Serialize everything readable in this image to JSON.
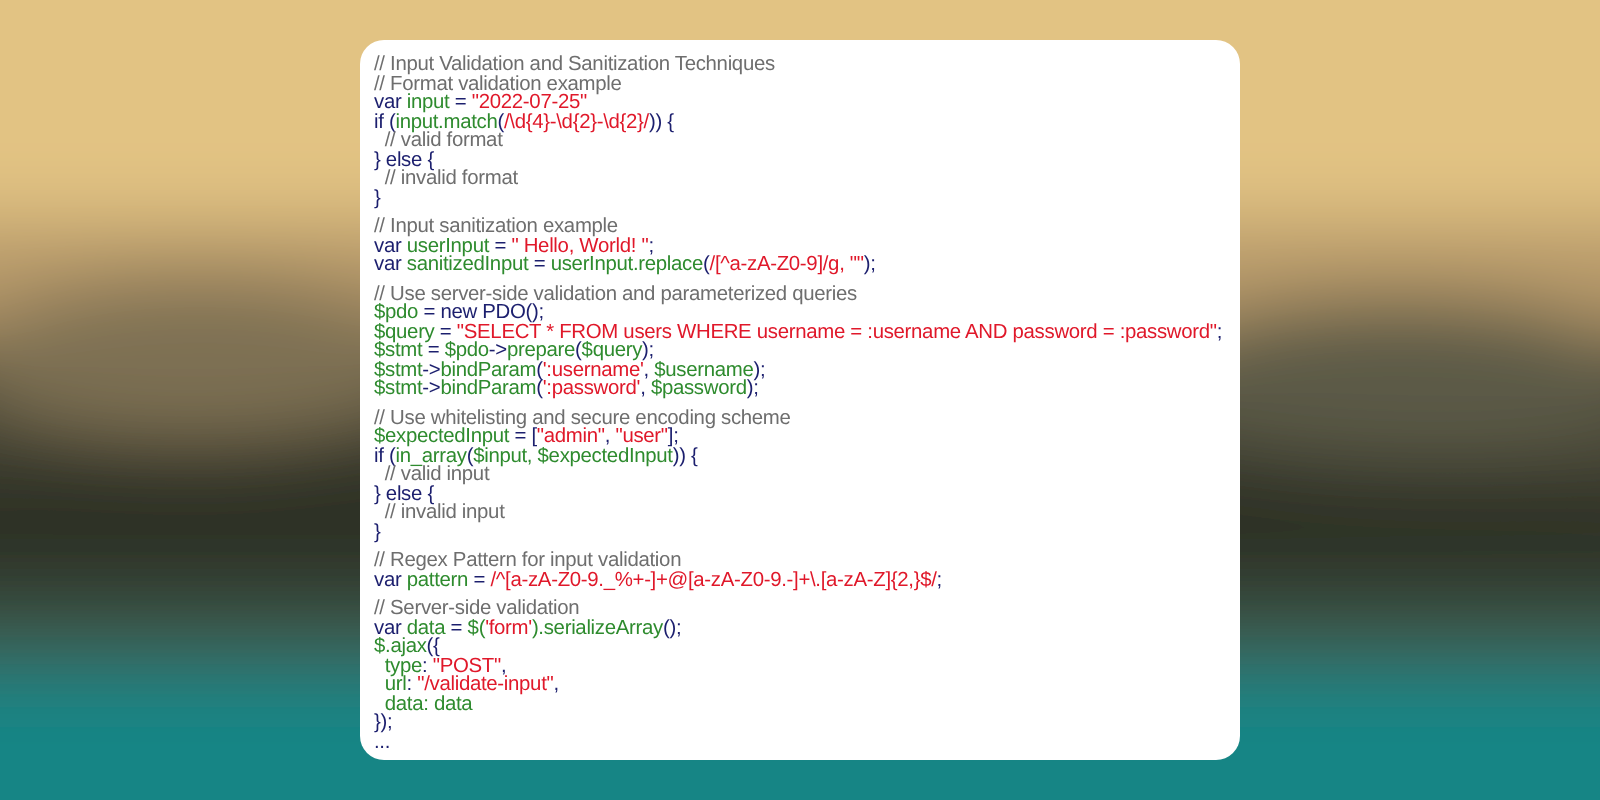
{
  "code_blocks": [
    {
      "lines": [
        [
          {
            "kind": "comment",
            "text": "// Input Validation and Sanitization Techniques"
          }
        ],
        [
          {
            "kind": "comment",
            "text": "// Format validation example"
          }
        ],
        [
          {
            "kind": "keyword",
            "text": "var "
          },
          {
            "kind": "ident",
            "text": "input"
          },
          {
            "kind": "keyword",
            "text": " = "
          },
          {
            "kind": "string",
            "text": "\"2022-07-25\""
          }
        ],
        [
          {
            "kind": "keyword",
            "text": "if ("
          },
          {
            "kind": "ident",
            "text": "input.match"
          },
          {
            "kind": "keyword",
            "text": "("
          },
          {
            "kind": "string",
            "text": "/\\d{4}-\\d{2}-\\d{2}/"
          },
          {
            "kind": "keyword",
            "text": ")) {"
          }
        ],
        [
          {
            "kind": "comment",
            "text": "  // valid format"
          }
        ],
        [
          {
            "kind": "keyword",
            "text": "} else {"
          }
        ],
        [
          {
            "kind": "comment",
            "text": "  // invalid format"
          }
        ],
        [
          {
            "kind": "keyword",
            "text": "}"
          }
        ]
      ]
    },
    {
      "lines": [
        [
          {
            "kind": "comment",
            "text": "// Input sanitization example"
          }
        ],
        [
          {
            "kind": "keyword",
            "text": "var "
          },
          {
            "kind": "ident",
            "text": "userInput"
          },
          {
            "kind": "keyword",
            "text": " = "
          },
          {
            "kind": "string",
            "text": "\" Hello, World! \""
          },
          {
            "kind": "keyword",
            "text": ";"
          }
        ],
        [
          {
            "kind": "keyword",
            "text": "var "
          },
          {
            "kind": "ident",
            "text": "sanitizedInput"
          },
          {
            "kind": "keyword",
            "text": " = "
          },
          {
            "kind": "ident",
            "text": "userInput.replace"
          },
          {
            "kind": "keyword",
            "text": "("
          },
          {
            "kind": "string",
            "text": "/[^a-zA-Z0-9]/g, \"\""
          },
          {
            "kind": "keyword",
            "text": ");"
          }
        ]
      ]
    },
    {
      "lines": [
        [
          {
            "kind": "comment",
            "text": "// Use server-side validation and parameterized queries"
          }
        ],
        [
          {
            "kind": "ident",
            "text": "$pdo"
          },
          {
            "kind": "keyword",
            "text": " = new PDO();"
          }
        ],
        [
          {
            "kind": "ident",
            "text": "$query"
          },
          {
            "kind": "keyword",
            "text": " = "
          },
          {
            "kind": "string",
            "text": "\"SELECT * FROM users WHERE username = :username AND password = :password\""
          },
          {
            "kind": "keyword",
            "text": ";"
          }
        ],
        [
          {
            "kind": "ident",
            "text": "$stmt"
          },
          {
            "kind": "keyword",
            "text": " = "
          },
          {
            "kind": "ident",
            "text": "$pdo"
          },
          {
            "kind": "keyword",
            "text": "->"
          },
          {
            "kind": "ident",
            "text": "prepare"
          },
          {
            "kind": "keyword",
            "text": "("
          },
          {
            "kind": "ident",
            "text": "$query"
          },
          {
            "kind": "keyword",
            "text": ");"
          }
        ],
        [
          {
            "kind": "ident",
            "text": "$stmt"
          },
          {
            "kind": "keyword",
            "text": "->"
          },
          {
            "kind": "ident",
            "text": "bindParam"
          },
          {
            "kind": "keyword",
            "text": "("
          },
          {
            "kind": "string",
            "text": "':username'"
          },
          {
            "kind": "keyword",
            "text": ", "
          },
          {
            "kind": "ident",
            "text": "$username"
          },
          {
            "kind": "keyword",
            "text": ");"
          }
        ],
        [
          {
            "kind": "ident",
            "text": "$stmt"
          },
          {
            "kind": "keyword",
            "text": "->"
          },
          {
            "kind": "ident",
            "text": "bindParam"
          },
          {
            "kind": "keyword",
            "text": "("
          },
          {
            "kind": "string",
            "text": "':password'"
          },
          {
            "kind": "keyword",
            "text": ", "
          },
          {
            "kind": "ident",
            "text": "$password"
          },
          {
            "kind": "keyword",
            "text": ");"
          }
        ]
      ]
    },
    {
      "lines": [
        [
          {
            "kind": "comment",
            "text": "// Use whitelisting and secure encoding scheme"
          }
        ],
        [
          {
            "kind": "ident",
            "text": "$expectedInput"
          },
          {
            "kind": "keyword",
            "text": " = ["
          },
          {
            "kind": "string",
            "text": "\"admin\""
          },
          {
            "kind": "keyword",
            "text": ", "
          },
          {
            "kind": "string",
            "text": "\"user\""
          },
          {
            "kind": "keyword",
            "text": "];"
          }
        ],
        [
          {
            "kind": "keyword",
            "text": "if ("
          },
          {
            "kind": "ident",
            "text": "in_array"
          },
          {
            "kind": "keyword",
            "text": "("
          },
          {
            "kind": "ident",
            "text": "$input, $expectedInput"
          },
          {
            "kind": "keyword",
            "text": ")) {"
          }
        ],
        [
          {
            "kind": "comment",
            "text": "  // valid input"
          }
        ],
        [
          {
            "kind": "keyword",
            "text": "} else {"
          }
        ],
        [
          {
            "kind": "comment",
            "text": "  // invalid input"
          }
        ],
        [
          {
            "kind": "keyword",
            "text": "}"
          }
        ]
      ]
    },
    {
      "lines": [
        [
          {
            "kind": "comment",
            "text": "// Regex Pattern for input validation"
          }
        ],
        [
          {
            "kind": "keyword",
            "text": "var "
          },
          {
            "kind": "ident",
            "text": "pattern"
          },
          {
            "kind": "keyword",
            "text": " = "
          },
          {
            "kind": "string",
            "text": "/^[a-zA-Z0-9._%+-]+@[a-zA-Z0-9.-]+\\.[a-zA-Z]{2,}$/"
          },
          {
            "kind": "keyword",
            "text": ";"
          }
        ]
      ]
    },
    {
      "lines": [
        [
          {
            "kind": "comment",
            "text": "// Server-side validation"
          }
        ],
        [
          {
            "kind": "keyword",
            "text": "var "
          },
          {
            "kind": "ident",
            "text": "data"
          },
          {
            "kind": "keyword",
            "text": " = "
          },
          {
            "kind": "ident",
            "text": "$("
          },
          {
            "kind": "string",
            "text": "'form'"
          },
          {
            "kind": "ident",
            "text": ").serializeArray"
          },
          {
            "kind": "keyword",
            "text": "();"
          }
        ],
        [
          {
            "kind": "ident",
            "text": "$.ajax"
          },
          {
            "kind": "keyword",
            "text": "({"
          }
        ],
        [
          {
            "kind": "ident",
            "text": "  type"
          },
          {
            "kind": "keyword",
            "text": ": "
          },
          {
            "kind": "string",
            "text": "\"POST\""
          },
          {
            "kind": "keyword",
            "text": ","
          }
        ],
        [
          {
            "kind": "ident",
            "text": "  url"
          },
          {
            "kind": "keyword",
            "text": ": "
          },
          {
            "kind": "string",
            "text": "\"/validate-input\""
          },
          {
            "kind": "keyword",
            "text": ","
          }
        ],
        [
          {
            "kind": "ident",
            "text": "  data: data"
          }
        ],
        [
          {
            "kind": "keyword",
            "text": "});"
          }
        ],
        [
          {
            "kind": "keyword",
            "text": "..."
          }
        ]
      ]
    }
  ]
}
